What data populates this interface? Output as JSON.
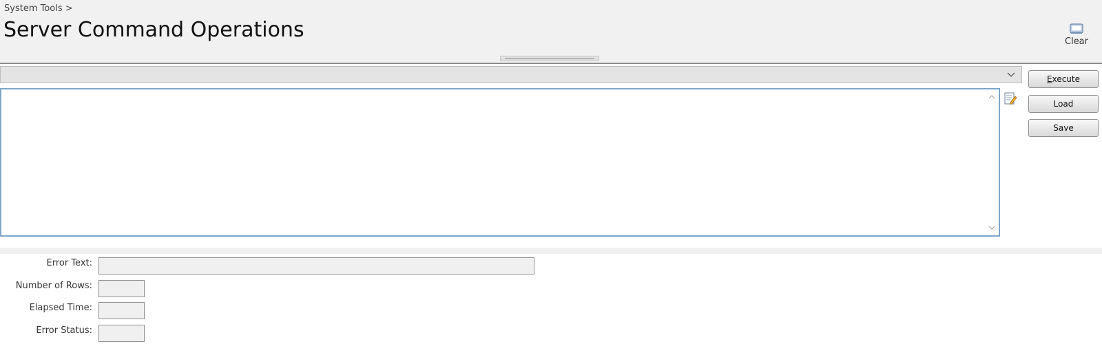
{
  "header": {
    "breadcrumb": "System Tools >",
    "title": "Server Command Operations",
    "clear_label": "Clear",
    "clear_icon": "clear-icon"
  },
  "command": {
    "selected": "",
    "text": ""
  },
  "buttons": {
    "execute_rest": "xecute",
    "execute_accesskey": "E",
    "load": "Load",
    "save": "Save"
  },
  "results": {
    "error_text_label": "Error Text:",
    "error_text_value": "",
    "rows_label": "Number of Rows:",
    "rows_value": "",
    "elapsed_label": "Elapsed Time:",
    "elapsed_value": "",
    "status_label": "Error Status:",
    "status_value": ""
  },
  "colors": {
    "header_bg": "#f1f1f1",
    "editor_border": "#7ea6c9",
    "field_bg": "#f0f0f0"
  }
}
